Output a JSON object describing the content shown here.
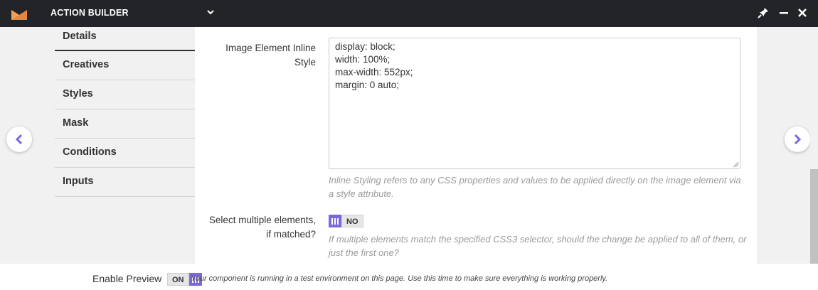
{
  "app": {
    "title": "ACTION BUILDER",
    "brand_color": "#e8873a",
    "accent_color": "#7a6ad8",
    "title_dropdown_icon": "chevron-down-icon",
    "window_controls": [
      "pin-icon",
      "minimize-icon",
      "close-icon"
    ]
  },
  "sidebar": {
    "items": [
      {
        "label": "Details",
        "active": true
      },
      {
        "label": "Creatives",
        "active": false
      },
      {
        "label": "Styles",
        "active": false
      },
      {
        "label": "Mask",
        "active": false
      },
      {
        "label": "Conditions",
        "active": false
      },
      {
        "label": "Inputs",
        "active": false
      }
    ]
  },
  "form": {
    "inline_style": {
      "label": "Image Element Inline Style",
      "value": "display: block;\nwidth: 100%;\nmax-width: 552px;\nmargin: 0 auto;",
      "help": "Inline Styling refers to any CSS properties and values to be applied directly on the image element via a style attribute."
    },
    "select_multiple": {
      "label": "Select multiple elements, if matched?",
      "toggle_label": "NO",
      "help": "If multiple elements match the specified CSS3 selector, should the change be applied to all of them, or just the first one?"
    }
  },
  "footer": {
    "label": "Enable Preview",
    "toggle_label": "ON",
    "note": "Your component is running in a test environment on this page. Use this time to make sure everything is working properly."
  }
}
